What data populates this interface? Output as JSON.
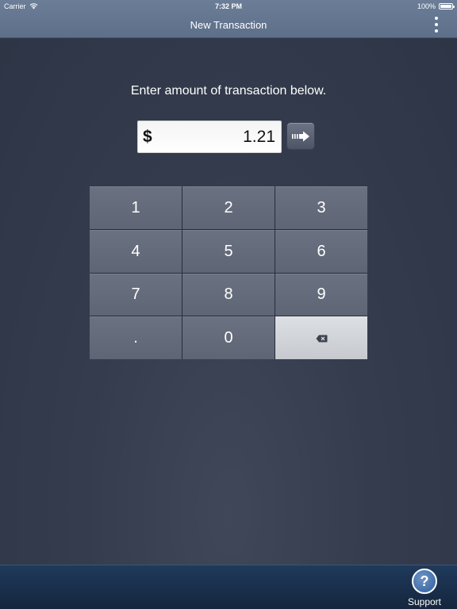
{
  "status_bar": {
    "carrier": "Carrier",
    "time": "7:32 PM",
    "battery": "100%"
  },
  "nav": {
    "title": "New Transaction"
  },
  "main": {
    "prompt": "Enter amount of transaction below.",
    "currency_symbol": "$",
    "amount_value": "1.21"
  },
  "keypad": {
    "keys": [
      "1",
      "2",
      "3",
      "4",
      "5",
      "6",
      "7",
      "8",
      "9",
      ".",
      "0"
    ]
  },
  "toolbar": {
    "support_label": "Support",
    "support_glyph": "?"
  },
  "colors": {
    "nav_bar": "#5d6f89",
    "background": "#2f3747",
    "key": "#636a7a",
    "key_light": "#d2d5d9",
    "toolbar": "#1a2f4b",
    "support_button": "#3b6aa8"
  },
  "icons": {
    "wifi": "wifi-icon",
    "battery": "battery-icon",
    "menu": "more-vertical-icon",
    "submit": "arrow-right-icon",
    "backspace": "backspace-icon",
    "support": "question-mark-icon"
  }
}
